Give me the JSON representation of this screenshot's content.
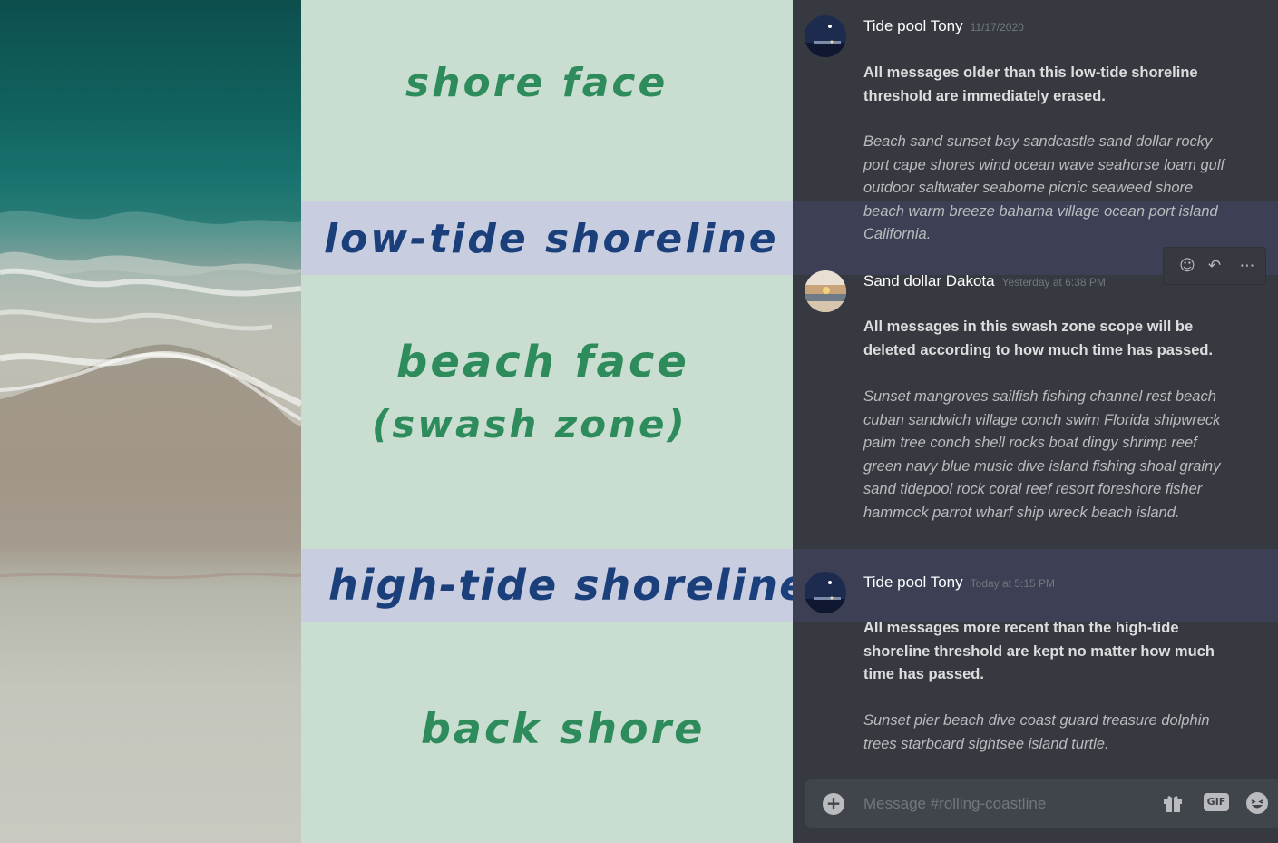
{
  "labels": {
    "shore_face": "shore face",
    "low_tide": "low-tide shoreline",
    "beach_face": "beach face",
    "swash_zone": "(swash zone)",
    "high_tide": "high-tide shoreline",
    "back_shore": "back shore"
  },
  "colors": {
    "label_background": "#c9ded0",
    "band_background": "#c9cde0",
    "zone_text": "#2e8c5c",
    "shoreline_text": "#1a3f7a",
    "chat_background": "#36393f",
    "chat_band": "#3d4054"
  },
  "messages": [
    {
      "username": "Tide pool Tony",
      "timestamp": "11/17/2020",
      "avatar_icon": "night-pier-avatar-icon",
      "bold": "All messages older than this low-tide shoreline threshold are immediately erased.",
      "italic": "Beach sand sunset bay sandcastle sand dollar rocky port cape shores wind ocean wave seahorse loam gulf outdoor saltwater seaborne picnic seaweed shore beach warm breeze bahama village ocean port island California."
    },
    {
      "username": "Sand dollar Dakota",
      "timestamp": "Yesterday at 6:38 PM",
      "avatar_icon": "sunset-beach-avatar-icon",
      "bold": "All messages in this swash zone scope will be deleted according to how much time has passed.",
      "italic": "Sunset mangroves sailfish fishing channel rest beach cuban sandwich village conch swim Florida shipwreck palm tree conch shell rocks boat dingy shrimp reef green navy blue music dive island fishing shoal grainy sand tidepool rock coral reef resort foreshore fisher hammock parrot wharf ship wreck beach island."
    },
    {
      "username": "Tide pool Tony",
      "timestamp": "Today at 5:15 PM",
      "avatar_icon": "night-pier-avatar-icon",
      "bold": "All messages more recent than the high-tide shoreline threshold are kept no matter how much time has passed.",
      "italic": "Sunset pier beach dive coast guard treasure dolphin trees starboard sightsee island turtle."
    }
  ],
  "message_actions": [
    "add-reaction-icon",
    "reply-icon",
    "more-options-icon"
  ],
  "composer": {
    "placeholder": "Message #rolling-coastline",
    "gif_label": "GIF",
    "icons": [
      "upload-plus-icon",
      "gift-icon",
      "gif-icon",
      "emoji-icon"
    ]
  }
}
